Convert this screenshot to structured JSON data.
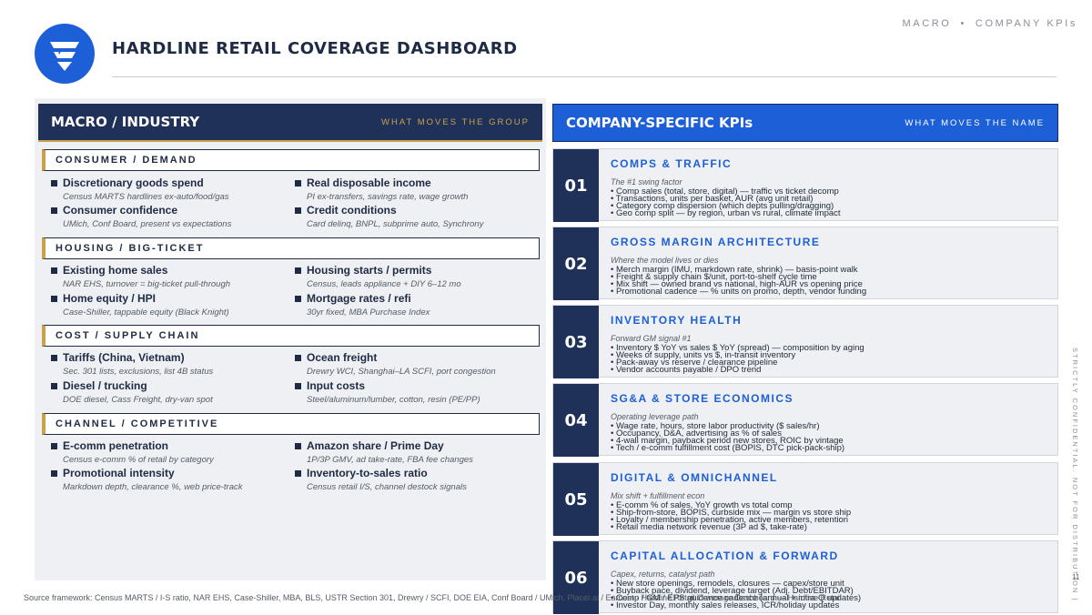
{
  "header": {
    "title": "HARDLINE RETAIL COVERAGE DASHBOARD",
    "breadcrumb": [
      "MACRO",
      "COMPANY KPIs"
    ],
    "separator": "•",
    "logo_icon": "chevron-stack-logo-icon"
  },
  "left": {
    "title": "MACRO / INDUSTRY",
    "subtitle": "WHAT MOVES THE GROUP",
    "sections": [
      {
        "label": "CONSUMER / DEMAND",
        "items": [
          {
            "title": "Discretionary goods spend",
            "sub": "Census MARTS hardlines ex-auto/food/gas"
          },
          {
            "title": "Real disposable income",
            "sub": "PI ex-transfers, savings rate, wage growth"
          },
          {
            "title": "Consumer confidence",
            "sub": "UMich, Conf Board, present vs expectations"
          },
          {
            "title": "Credit conditions",
            "sub": "Card delinq, BNPL, subprime auto, Synchrony"
          }
        ]
      },
      {
        "label": "HOUSING / BIG-TICKET",
        "items": [
          {
            "title": "Existing home sales",
            "sub": "NAR EHS, turnover = big-ticket pull-through"
          },
          {
            "title": "Housing starts / permits",
            "sub": "Census, leads appliance + DIY 6–12 mo"
          },
          {
            "title": "Home equity / HPI",
            "sub": "Case-Shiller, tappable equity (Black Knight)"
          },
          {
            "title": "Mortgage rates / refi",
            "sub": "30yr fixed, MBA Purchase Index"
          }
        ]
      },
      {
        "label": "COST / SUPPLY CHAIN",
        "items": [
          {
            "title": "Tariffs (China, Vietnam)",
            "sub": "Sec. 301 lists, exclusions, list 4B status"
          },
          {
            "title": "Ocean freight",
            "sub": "Drewry WCI, Shanghai–LA SCFI, port congestion"
          },
          {
            "title": "Diesel / trucking",
            "sub": "DOE diesel, Cass Freight, dry-van spot"
          },
          {
            "title": "Input costs",
            "sub": "Steel/aluminum/lumber, cotton, resin (PE/PP)"
          }
        ]
      },
      {
        "label": "CHANNEL / COMPETITIVE",
        "items": [
          {
            "title": "E-comm penetration",
            "sub": "Census e-comm % of retail by category"
          },
          {
            "title": "Amazon share / Prime Day",
            "sub": "1P/3P GMV, ad take-rate, FBA fee changes"
          },
          {
            "title": "Promotional intensity",
            "sub": "Markdown depth, clearance %, web price-track"
          },
          {
            "title": "Inventory-to-sales ratio",
            "sub": "Census retail I/S, channel destock signals"
          }
        ]
      }
    ]
  },
  "right": {
    "title": "COMPANY-SPECIFIC KPIs",
    "subtitle": "WHAT MOVES THE NAME",
    "kpis": [
      {
        "num": "01",
        "title": "COMPS & TRAFFIC",
        "sub": "The #1 swing factor",
        "bullets": [
          "Comp sales (total, store, digital) — traffic vs ticket decomp",
          "Transactions, units per basket, AUR (avg unit retail)",
          "Category comp dispersion (which depts pulling/dragging)",
          "Geo comp split — by region, urban vs rural, climate impact"
        ]
      },
      {
        "num": "02",
        "title": "GROSS MARGIN ARCHITECTURE",
        "sub": "Where the model lives or dies",
        "bullets": [
          "Merch margin (IMU, markdown rate, shrink) — basis-point walk",
          "Freight & supply chain $/unit, port-to-shelf cycle time",
          "Mix shift — owned brand vs national, high-AUR vs opening price",
          "Promotional cadence — % units on promo, depth, vendor funding"
        ]
      },
      {
        "num": "03",
        "title": "INVENTORY HEALTH",
        "sub": "Forward GM signal #1",
        "bullets": [
          "Inventory $ YoY vs sales $ YoY (spread) — composition by aging",
          "Weeks of supply, units vs $, in-transit inventory",
          "Pack-away vs reserve / clearance pipeline",
          "Vendor accounts payable / DPO trend"
        ]
      },
      {
        "num": "04",
        "title": "SG&A & STORE ECONOMICS",
        "sub": "Operating leverage path",
        "bullets": [
          "Wage rate, hours, store labor productivity ($ sales/hr)",
          "Occupancy, D&A, advertising as % of sales",
          "4-wall margin, payback period new stores, ROIC by vintage",
          "Tech / e-comm fulfillment cost (BOPIS, DTC pick-pack-ship)"
        ]
      },
      {
        "num": "05",
        "title": "DIGITAL & OMNICHANNEL",
        "sub": "Mix shift + fulfillment econ",
        "bullets": [
          "E-comm % of sales, YoY growth vs total comp",
          "Ship-from-store, BOPIS, curbside mix — margin vs store ship",
          "Loyalty / membership penetration, active members, retention",
          "Retail media network revenue (3P ad $, take-rate)"
        ]
      },
      {
        "num": "06",
        "title": "CAPITAL ALLOCATION & FORWARD",
        "sub": "Capex, returns, catalyst path",
        "bullets": [
          "New store openings, remodels, closures — capex/store unit",
          "Buyback pace, dividend, leverage target (Adj. Debt/EBITDAR)",
          "Comp / GM / EPS guidance cadence (annual + intra-Q updates)",
          "Investor Day, monthly sales releases, ICR/holiday updates"
        ]
      }
    ]
  },
  "footer": {
    "source": "Source framework: Census MARTS / I-S ratio, NAR EHS, Case-Shiller, MBA, BLS, USTR Section 301, Drewry / SCFI, DOE EIA, Conf Board / UMich, Placer.ai / Earnest · Hardline Retail Coverage Dashboard — Hardline Retail",
    "confidential": "STRICTLY CONFIDENTIAL. NOT FOR DISTRIBUTION",
    "divider": "|",
    "page": "11"
  },
  "colors": {
    "navy": "#1f3158",
    "blue": "#1d5fd6",
    "gold": "#c9a24a",
    "panel": "#eef0f3"
  }
}
